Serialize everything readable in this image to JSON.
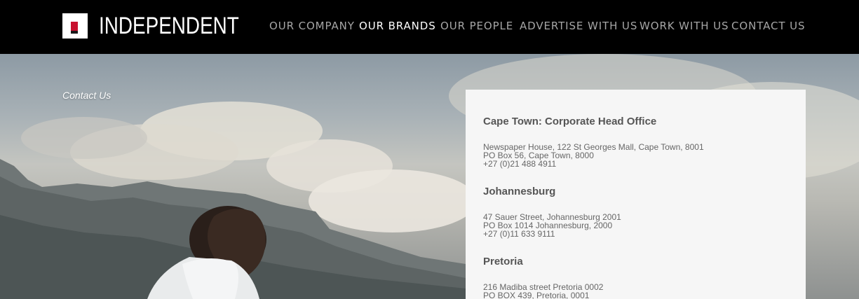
{
  "brand": {
    "name": "INDEPENDENT",
    "logo_red": "#c8102e"
  },
  "nav": {
    "items": [
      {
        "label": "OUR COMPANY",
        "active": false
      },
      {
        "label": "OUR BRANDS",
        "active": true
      },
      {
        "label": "OUR PEOPLE",
        "active": false
      },
      {
        "label": "ADVERTISE WITH US",
        "active": false
      },
      {
        "label": "WORK WITH US",
        "active": false
      },
      {
        "label": "CONTACT US",
        "active": false
      }
    ]
  },
  "breadcrumb": "Contact Us",
  "offices": [
    {
      "title": "Cape Town: Corporate Head Office",
      "lines": [
        "Newspaper House, 122 St Georges Mall, Cape Town, 8001",
        "PO Box 56, Cape Town, 8000",
        "+27 (0)21 488 4911"
      ]
    },
    {
      "title": "Johannesburg",
      "lines": [
        "47 Sauer Street, Johannesburg 2001",
        "PO Box 1014 Johannesburg, 2000",
        "+27 (0)11 633 9111"
      ]
    },
    {
      "title": "Pretoria",
      "lines": [
        "216 Madiba street Pretoria 0002",
        "PO BOX 439, Pretoria, 0001"
      ]
    }
  ]
}
